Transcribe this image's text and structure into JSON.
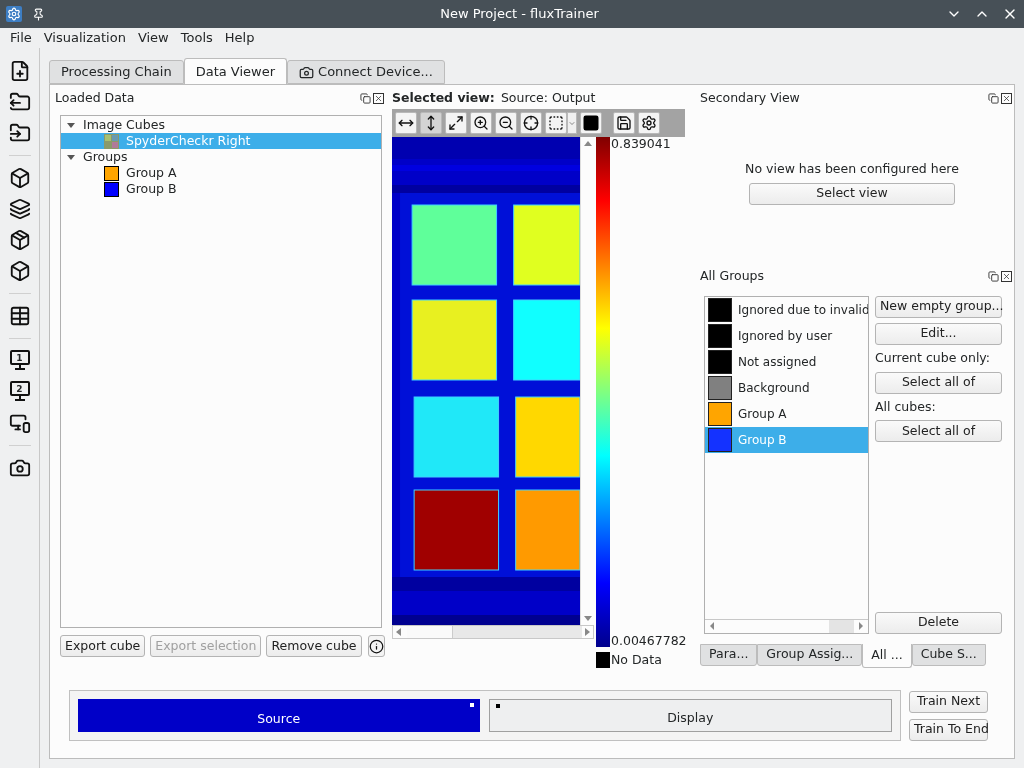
{
  "window": {
    "title": "New Project - fluxTrainer"
  },
  "menu": [
    "File",
    "Visualization",
    "View",
    "Tools",
    "Help"
  ],
  "toolbar": [
    {
      "kind": "new-file"
    },
    {
      "kind": "export-folder"
    },
    {
      "kind": "import-folder"
    },
    {
      "kind": "sep"
    },
    {
      "kind": "cube-out"
    },
    {
      "kind": "layers-out"
    },
    {
      "kind": "cube-dotted"
    },
    {
      "kind": "cube-in"
    },
    {
      "kind": "sep"
    },
    {
      "kind": "table-in"
    },
    {
      "kind": "sep"
    },
    {
      "kind": "monitor",
      "number": "1"
    },
    {
      "kind": "monitor",
      "number": "2"
    },
    {
      "kind": "monitors"
    },
    {
      "kind": "sep"
    },
    {
      "kind": "camera"
    }
  ],
  "tabs": [
    {
      "label": "Processing Chain",
      "selected": false,
      "kind": "plain"
    },
    {
      "label": "Data Viewer",
      "selected": true,
      "kind": "plain"
    },
    {
      "label": "Connect Device...",
      "selected": false,
      "kind": "camera"
    }
  ],
  "loaded_data": {
    "title": "Loaded Data",
    "tree": [
      {
        "label": "Image Cubes",
        "expanded": true,
        "children": [
          {
            "label": "SpyderCheckr Right",
            "kind": "cube",
            "selected": true
          }
        ]
      },
      {
        "label": "Groups",
        "expanded": true,
        "children": [
          {
            "label": "Group A",
            "kind": "group",
            "color": "#ffa500",
            "selected": false
          },
          {
            "label": "Group B",
            "kind": "group",
            "color": "#0000ff",
            "selected": false
          }
        ]
      }
    ],
    "buttons": [
      {
        "label": "Export cube",
        "disabled": false
      },
      {
        "label": "Export selection",
        "disabled": true
      },
      {
        "label": "Remove cube",
        "disabled": false
      }
    ]
  },
  "viewer": {
    "heading": "Selected view:",
    "source": "Source: Output",
    "tools": [
      {
        "kind": "fit-width",
        "selected": false
      },
      {
        "kind": "fit-height",
        "selected": true
      },
      {
        "kind": "fit-all",
        "selected": false
      },
      {
        "kind": "zoom-in",
        "selected": false
      },
      {
        "kind": "zoom-out",
        "selected": false
      },
      {
        "kind": "crosshair",
        "selected": false
      },
      {
        "kind": "select",
        "selected": false
      },
      {
        "kind": "mask",
        "selected": false
      },
      {
        "kind": "save",
        "selected": false
      },
      {
        "kind": "settings",
        "selected": false
      }
    ],
    "scale_max": "0.839041",
    "scale_min": "0.00467782",
    "no_data": "No Data"
  },
  "secondary": {
    "title": "Secondary View",
    "message": "No view has been configured here",
    "button": "Select view"
  },
  "all_groups": {
    "title": "All Groups",
    "items": [
      {
        "label": "Ignored due to invalid",
        "color": "#000000",
        "selected": false
      },
      {
        "label": "Ignored by user",
        "color": "#000000",
        "selected": false
      },
      {
        "label": "Not assigned",
        "color": "#000000",
        "selected": false
      },
      {
        "label": "Background",
        "color": "#808080",
        "selected": false
      },
      {
        "label": "Group A",
        "color": "#ffa500",
        "selected": false
      },
      {
        "label": "Group B",
        "color": "#1432ff",
        "selected": true
      }
    ],
    "new_button": "New empty group...",
    "edit_button": "Edit...",
    "current_label": "Current cube only:",
    "current_button": "Select all of",
    "all_label": "All cubes:",
    "all_button": "Select all of",
    "delete_button": "Delete",
    "tabs": [
      {
        "label": "Para...",
        "selected": false
      },
      {
        "label": "Group Assig...",
        "selected": false
      },
      {
        "label": "All ...",
        "selected": true
      },
      {
        "label": "Cube S...",
        "selected": false
      }
    ]
  },
  "bottom": {
    "views": [
      {
        "label": "Source",
        "selected": true
      },
      {
        "label": "Display",
        "selected": false
      }
    ],
    "buttons": [
      "Train Next",
      "Train To End"
    ]
  }
}
